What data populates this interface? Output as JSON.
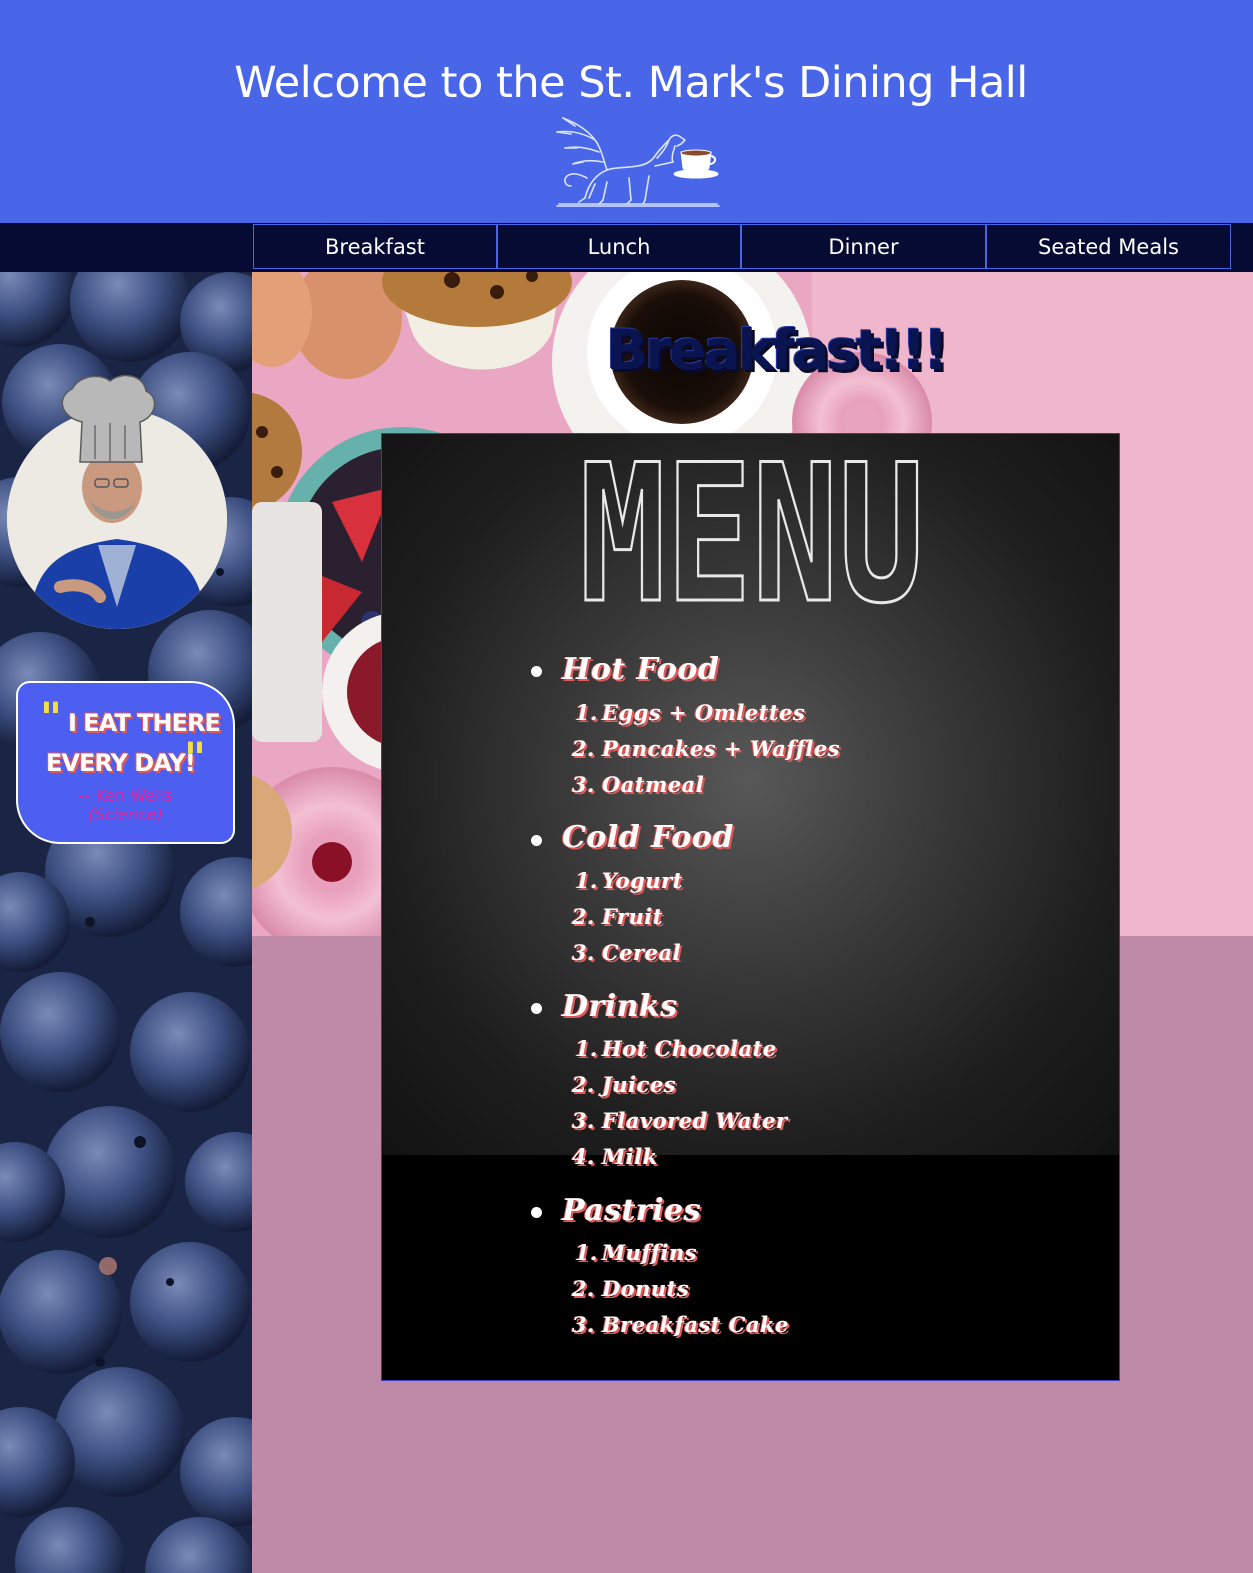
{
  "header": {
    "title": "Welcome to the St. Mark's Dining Hall",
    "logo_icon": "griffin-with-teacup-logo",
    "bg_color": "#4a66e8"
  },
  "nav": {
    "items": [
      {
        "label": "Breakfast"
      },
      {
        "label": "Lunch"
      },
      {
        "label": "Dinner"
      },
      {
        "label": "Seated Meals"
      }
    ],
    "bg_color": "#050b33"
  },
  "sidebar": {
    "background": "blueberries-photo",
    "quote": {
      "line1": "I EAT THERE",
      "line2": "EVERY DAY!",
      "author": "-- Ken Wells",
      "department": "(Science)"
    }
  },
  "main": {
    "heading": "Breakfast!!!",
    "hero_image": "breakfast-spread-photo",
    "menu_title": "MENU",
    "categories": [
      {
        "name": "Hot Food",
        "items": [
          "Eggs + Omlettes",
          "Pancakes + Waffles",
          "Oatmeal"
        ]
      },
      {
        "name": "Cold Food",
        "items": [
          "Yogurt",
          "Fruit",
          "Cereal"
        ]
      },
      {
        "name": "Drinks",
        "items": [
          "Hot Chocolate",
          "Juices",
          "Flavored Water",
          "Milk"
        ]
      },
      {
        "name": "Pastries",
        "items": [
          "Muffins",
          "Donuts",
          "Breakfast Cake"
        ]
      }
    ],
    "page_bg": "#bf8aa8"
  }
}
